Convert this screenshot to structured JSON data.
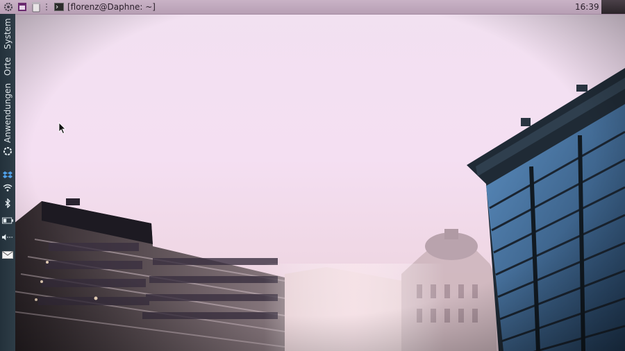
{
  "top_panel": {
    "window_title": "[florenz@Daphne: ~]",
    "clock": "16:39"
  },
  "left_panel": {
    "menus": [
      "System",
      "Orte",
      "Anwendungen"
    ]
  },
  "icons": {
    "top": [
      "gear-icon",
      "calendar-icon",
      "trash-icon",
      "separator-handle",
      "terminal-icon"
    ],
    "tray": [
      "network-icon",
      "dropbox-icon",
      "wifi-icon",
      "bluetooth-icon",
      "battery-icon",
      "volume-icon",
      "mail-icon"
    ]
  },
  "colors": {
    "sky": "#f2e1f1",
    "panel_top": "#c9b3c6",
    "panel_left": "#2b3943",
    "building_dark": "#1f2a35",
    "glass_blue": "#3f6f9f"
  }
}
